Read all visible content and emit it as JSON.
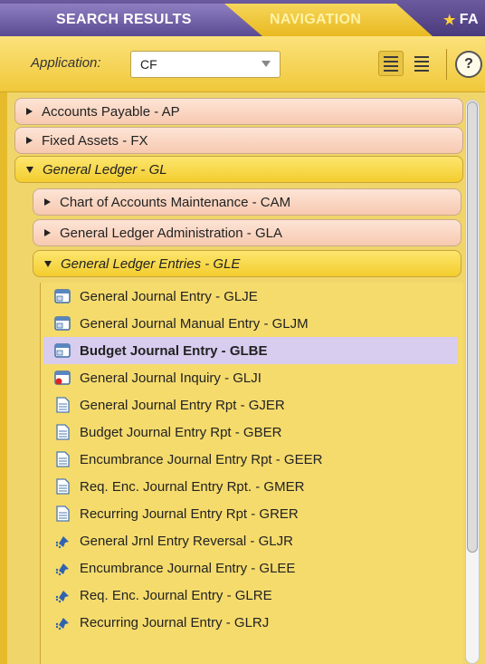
{
  "tabs": {
    "search_results": "SEARCH RESULTS",
    "navigation": "NAVIGATION",
    "favorites": "FA"
  },
  "toolbar": {
    "application_label": "Application:",
    "application_value": "CF",
    "help_label": "?"
  },
  "tree": {
    "top": [
      {
        "label": "Accounts Payable - AP"
      },
      {
        "label": "Fixed Assets - FX"
      },
      {
        "label": "General Ledger - GL"
      }
    ],
    "gl_children": [
      {
        "label": "Chart of Accounts Maintenance - CAM"
      },
      {
        "label": "General Ledger Administration - GLA"
      },
      {
        "label": "General Ledger Entries - GLE"
      }
    ],
    "gle_items": [
      {
        "label": "General Journal Entry - GLJE",
        "icon": "form-icon"
      },
      {
        "label": "General Journal Manual Entry - GLJM",
        "icon": "form-icon"
      },
      {
        "label": "Budget Journal Entry - GLBE",
        "icon": "form-icon",
        "selected": true
      },
      {
        "label": "General Journal Inquiry - GLJI",
        "icon": "inquiry-form-icon"
      },
      {
        "label": "General Journal Entry Rpt - GJER",
        "icon": "report-icon"
      },
      {
        "label": "Budget Journal Entry Rpt - GBER",
        "icon": "report-icon"
      },
      {
        "label": "Encumbrance Journal Entry Rpt - GEER",
        "icon": "report-icon"
      },
      {
        "label": "Req. Enc. Journal Entry Rpt. - GMER",
        "icon": "report-icon"
      },
      {
        "label": "Recurring Journal Entry Rpt - GRER",
        "icon": "report-icon"
      },
      {
        "label": "General Jrnl Entry Reversal - GLJR",
        "icon": "process-icon"
      },
      {
        "label": "Encumbrance Journal Entry - GLEE",
        "icon": "process-icon"
      },
      {
        "label": "Req. Enc. Journal Entry - GLRE",
        "icon": "process-icon"
      },
      {
        "label": "Recurring Journal Entry - GLRJ",
        "icon": "process-icon"
      }
    ]
  },
  "colors": {
    "selected_row": "#d8ccef",
    "panel": "#f0d66a",
    "collapsed_row": "#f7c9b0"
  }
}
